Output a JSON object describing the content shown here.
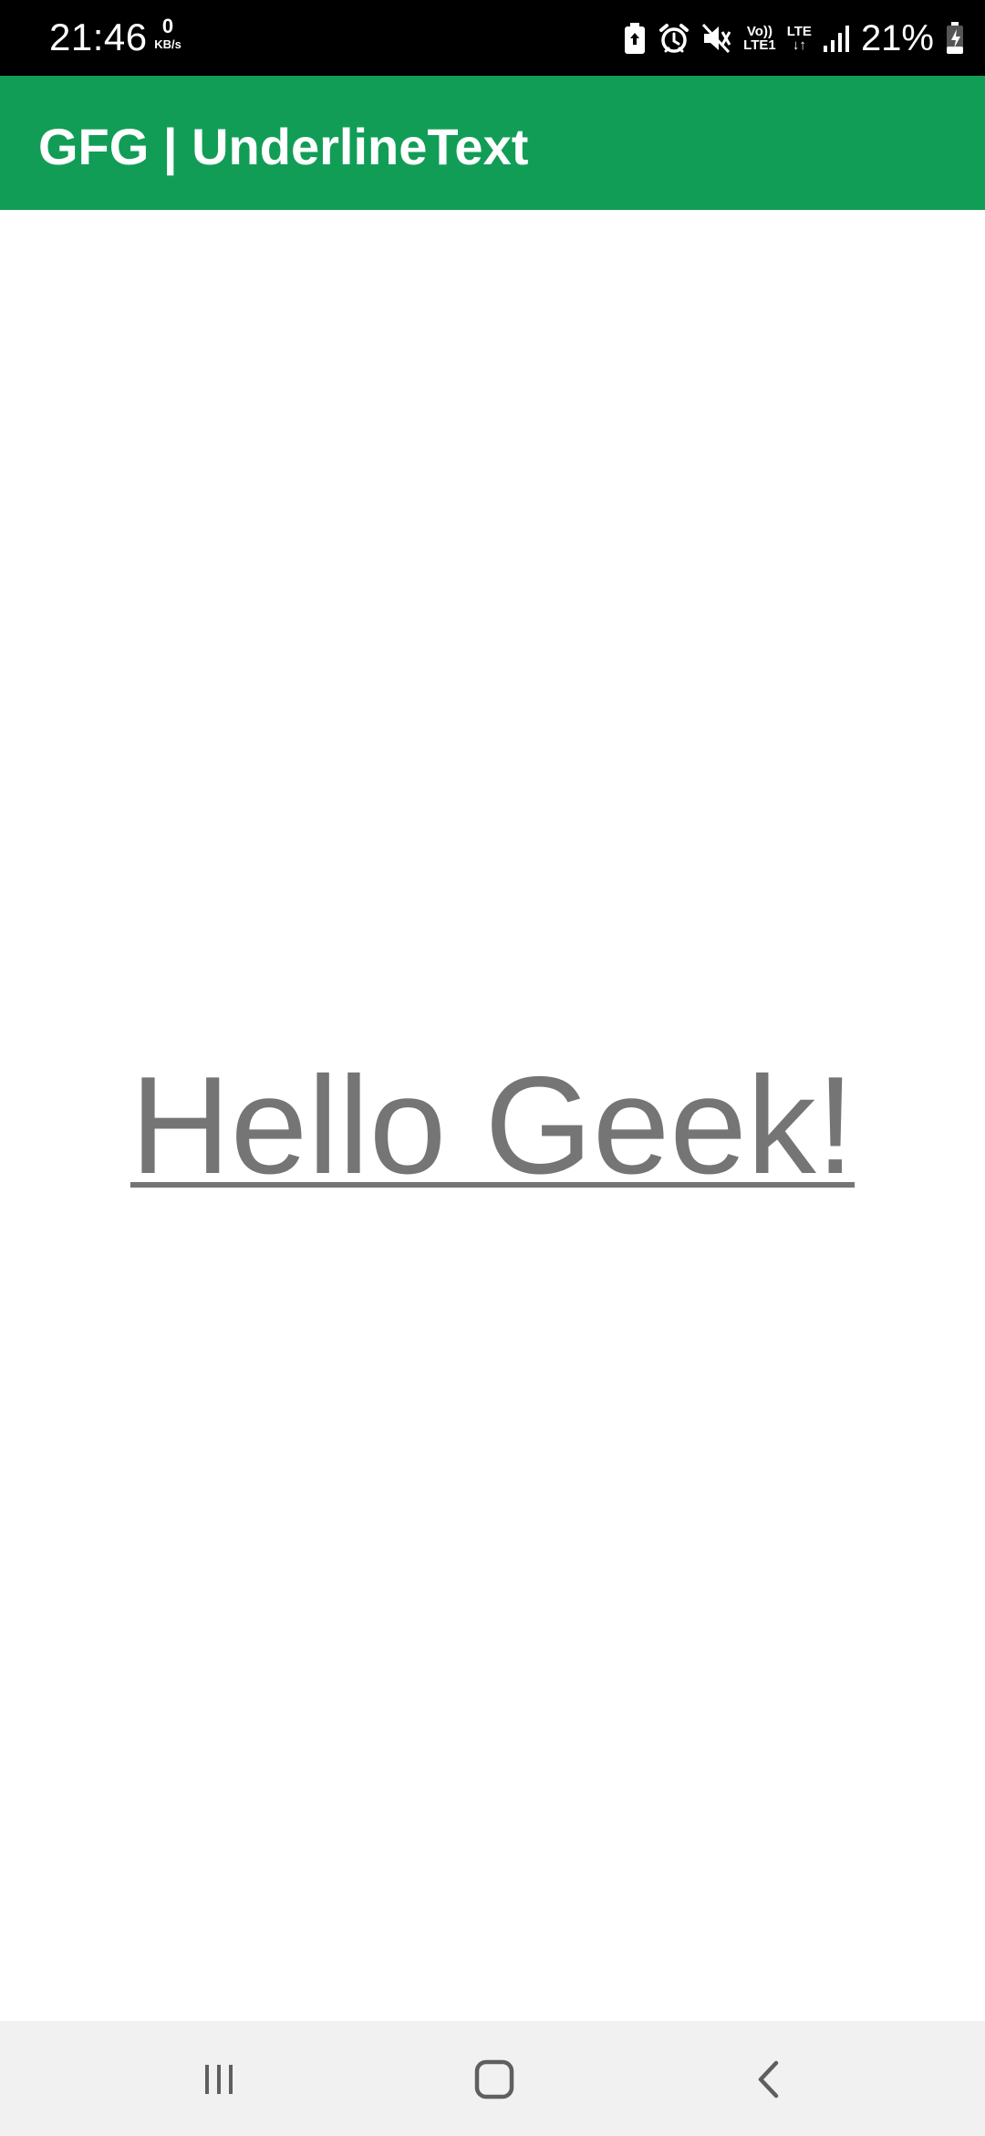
{
  "status_bar": {
    "time": "21:46",
    "data_speed_value": "0",
    "data_speed_unit": "KB/s",
    "network_volte": "Vo))",
    "network_lte1": "LTE1",
    "network_lte": "LTE",
    "battery_percent": "21%",
    "icons": [
      "battery-saver-icon",
      "alarm-icon",
      "mute-icon",
      "volte-icon",
      "lte-data-icon",
      "signal-icon",
      "battery-charging-icon"
    ]
  },
  "app_bar": {
    "title": "GFG | UnderlineText",
    "color": "#129d57"
  },
  "content": {
    "text": "Hello Geek!",
    "text_color": "#757575",
    "underlined": true
  },
  "nav_bar": {
    "icons": [
      "recent-apps-icon",
      "home-icon",
      "back-icon"
    ]
  }
}
